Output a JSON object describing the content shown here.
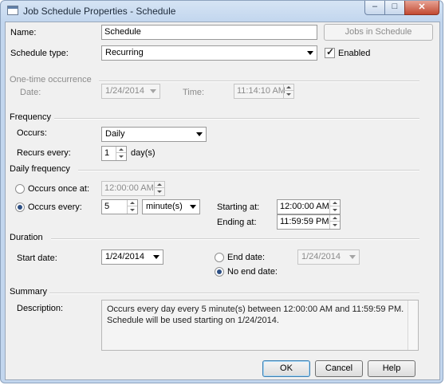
{
  "window": {
    "title": "Job Schedule Properties - Schedule",
    "caption_min": "–",
    "caption_max": "□",
    "caption_close": "✕"
  },
  "form": {
    "name_label": "Name:",
    "name_value": "Schedule",
    "jobs_button": "Jobs in Schedule",
    "schedule_type_label": "Schedule type:",
    "schedule_type_value": "Recurring",
    "enabled_label": "Enabled",
    "enabled_checked": true
  },
  "one_time": {
    "section": "One-time occurrence",
    "date_label": "Date:",
    "date_value": "1/24/2014",
    "time_label": "Time:",
    "time_value": "11:14:10 AM"
  },
  "frequency": {
    "section": "Frequency",
    "occurs_label": "Occurs:",
    "occurs_value": "Daily",
    "recurs_label": "Recurs every:",
    "recurs_value": "1",
    "recurs_unit": "day(s)"
  },
  "daily": {
    "section": "Daily frequency",
    "once_label": "Occurs once at:",
    "once_value": "12:00:00 AM",
    "every_label": "Occurs every:",
    "every_value": "5",
    "every_unit": "minute(s)",
    "selected": "every",
    "starting_label": "Starting at:",
    "starting_value": "12:00:00 AM",
    "ending_label": "Ending at:",
    "ending_value": "11:59:59 PM"
  },
  "duration": {
    "section": "Duration",
    "start_label": "Start date:",
    "start_value": "1/24/2014",
    "end_label": "End date:",
    "end_value": "1/24/2014",
    "no_end_label": "No end date:",
    "selected": "no_end"
  },
  "summary": {
    "section": "Summary",
    "description_label": "Description:",
    "description_text": "Occurs every day every 5 minute(s) between 12:00:00 AM and 11:59:59 PM. Schedule will be used starting on 1/24/2014."
  },
  "buttons": {
    "ok": "OK",
    "cancel": "Cancel",
    "help": "Help"
  }
}
